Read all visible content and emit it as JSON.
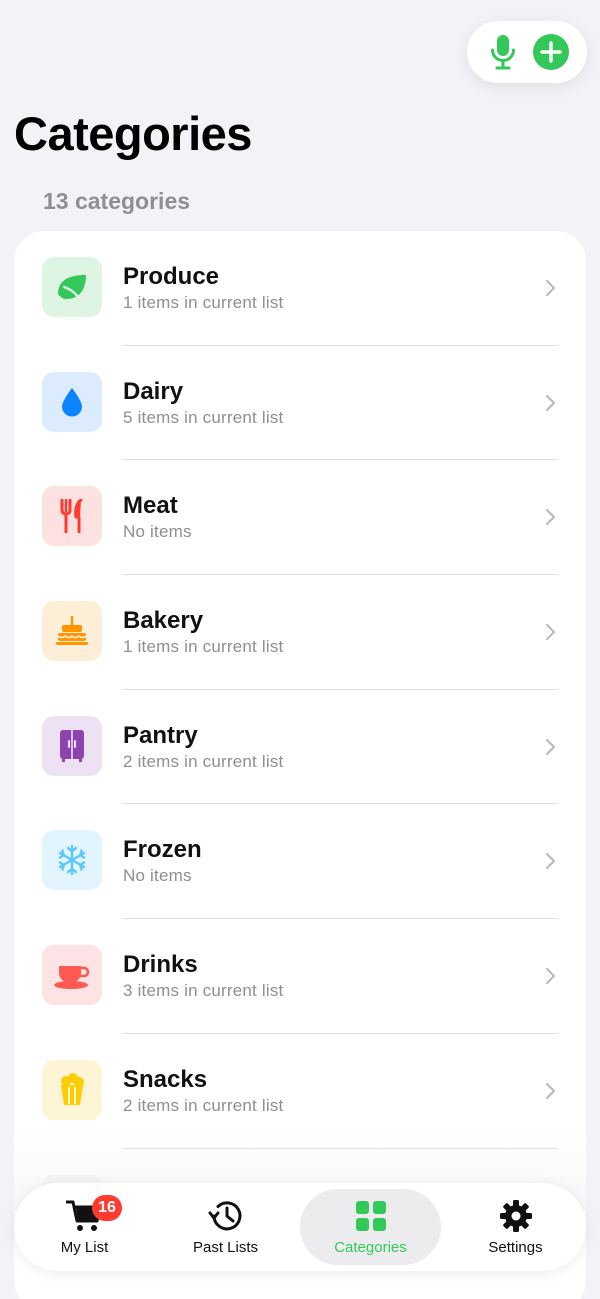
{
  "header": {
    "title": "Categories",
    "count_label": "13 categories"
  },
  "actions": {
    "mic_icon": "microphone-icon",
    "add_icon": "plus-circle-icon",
    "accent": "#34c759"
  },
  "categories": [
    {
      "name": "Produce",
      "sub": "1 items in current list",
      "icon": "leaf-icon",
      "bg": "#dff5e3",
      "color": "#34c759"
    },
    {
      "name": "Dairy",
      "sub": "5 items in current list",
      "icon": "drop-icon",
      "bg": "#dcebfd",
      "color": "#0a84ff"
    },
    {
      "name": "Meat",
      "sub": "No items",
      "icon": "fork-knife-icon",
      "bg": "#fde1e1",
      "color": "#ff3b30"
    },
    {
      "name": "Bakery",
      "sub": "1 items in current list",
      "icon": "cake-icon",
      "bg": "#fdeed8",
      "color": "#ff9500"
    },
    {
      "name": "Pantry",
      "sub": "2 items in current list",
      "icon": "cabinet-icon",
      "bg": "#ede1f4",
      "color": "#8e44ad"
    },
    {
      "name": "Frozen",
      "sub": "No items",
      "icon": "snowflake-icon",
      "bg": "#e2f4fd",
      "color": "#5ac8fa"
    },
    {
      "name": "Drinks",
      "sub": "3 items in current list",
      "icon": "cup-icon",
      "bg": "#fde3e3",
      "color": "#ff5a52"
    },
    {
      "name": "Snacks",
      "sub": "2 items in current list",
      "icon": "popcorn-icon",
      "bg": "#fdf5d6",
      "color": "#ffcc00"
    }
  ],
  "tabs": [
    {
      "label": "My List",
      "icon": "cart-icon",
      "badge": "16"
    },
    {
      "label": "Past Lists",
      "icon": "history-icon"
    },
    {
      "label": "Categories",
      "icon": "grid-icon",
      "active": true
    },
    {
      "label": "Settings",
      "icon": "gear-icon"
    }
  ]
}
